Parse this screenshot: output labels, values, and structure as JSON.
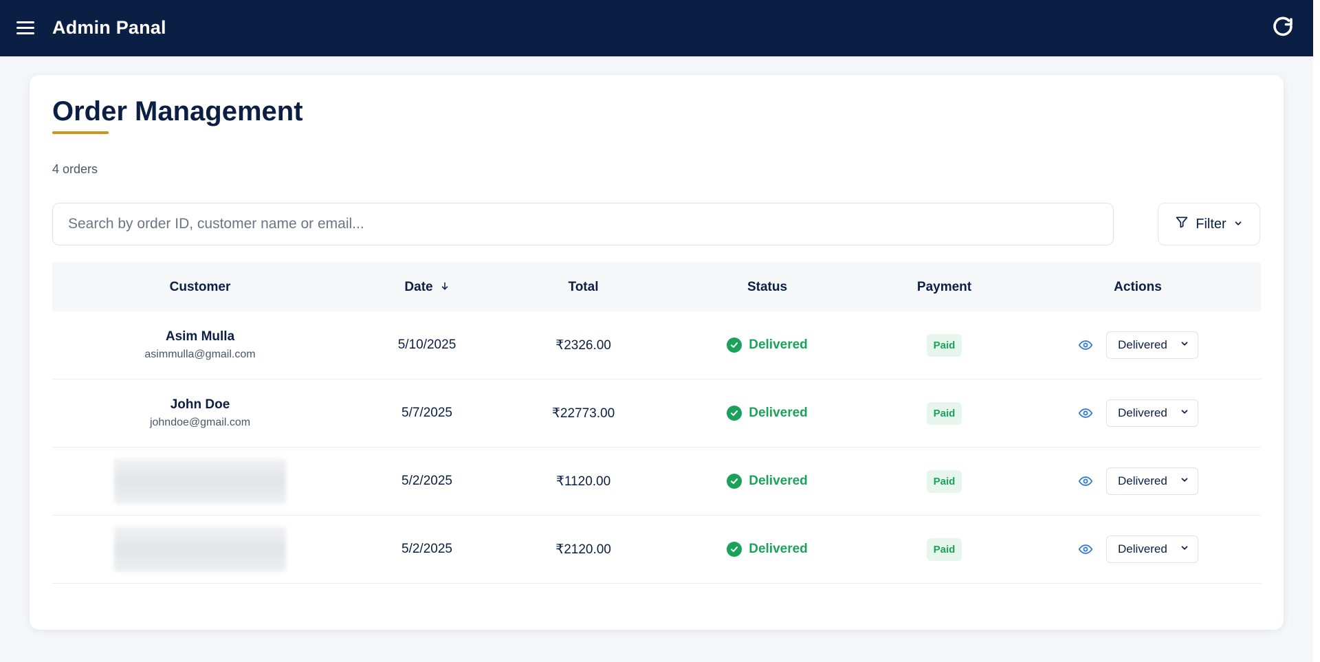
{
  "header": {
    "app_title": "Admin Panal",
    "menu_icon": "hamburger-menu-icon",
    "refresh_icon": "refresh-icon",
    "bg_color": "#0b1f45"
  },
  "page": {
    "title": "Order Management",
    "order_count": "4 orders",
    "accent_color": "#c9961f"
  },
  "search": {
    "placeholder": "Search by order ID, customer name or email...",
    "value": ""
  },
  "filter": {
    "label": "Filter",
    "icon": "funnel-icon",
    "chevron": "chevron-down-icon"
  },
  "table": {
    "headers": {
      "customer": "Customer",
      "date": "Date",
      "total": "Total",
      "status": "Status",
      "payment": "Payment",
      "actions": "Actions"
    },
    "sort_icon": "arrow-down-icon",
    "rows": [
      {
        "name": "Asim Mulla",
        "email": "asimmulla@gmail.com",
        "date": "5/10/2025",
        "total": "₹2326.00",
        "status": "Delivered",
        "payment": "Paid",
        "action_select": "Delivered"
      },
      {
        "name": "John Doe",
        "email": "johndoe@gmail.com",
        "date": "5/7/2025",
        "total": "₹22773.00",
        "status": "Delivered",
        "payment": "Paid",
        "action_select": "Delivered"
      },
      {
        "name": "",
        "email": "",
        "date": "5/2/2025",
        "total": "₹1120.00",
        "status": "Delivered",
        "payment": "Paid",
        "action_select": "Delivered"
      },
      {
        "name": "",
        "email": "",
        "date": "5/2/2025",
        "total": "₹2120.00",
        "status": "Delivered",
        "payment": "Paid",
        "action_select": "Delivered"
      }
    ]
  },
  "colors": {
    "status_green": "#1aa25a",
    "paid_badge_bg": "#e7f6ed",
    "eye_blue": "#2f7bd6"
  }
}
